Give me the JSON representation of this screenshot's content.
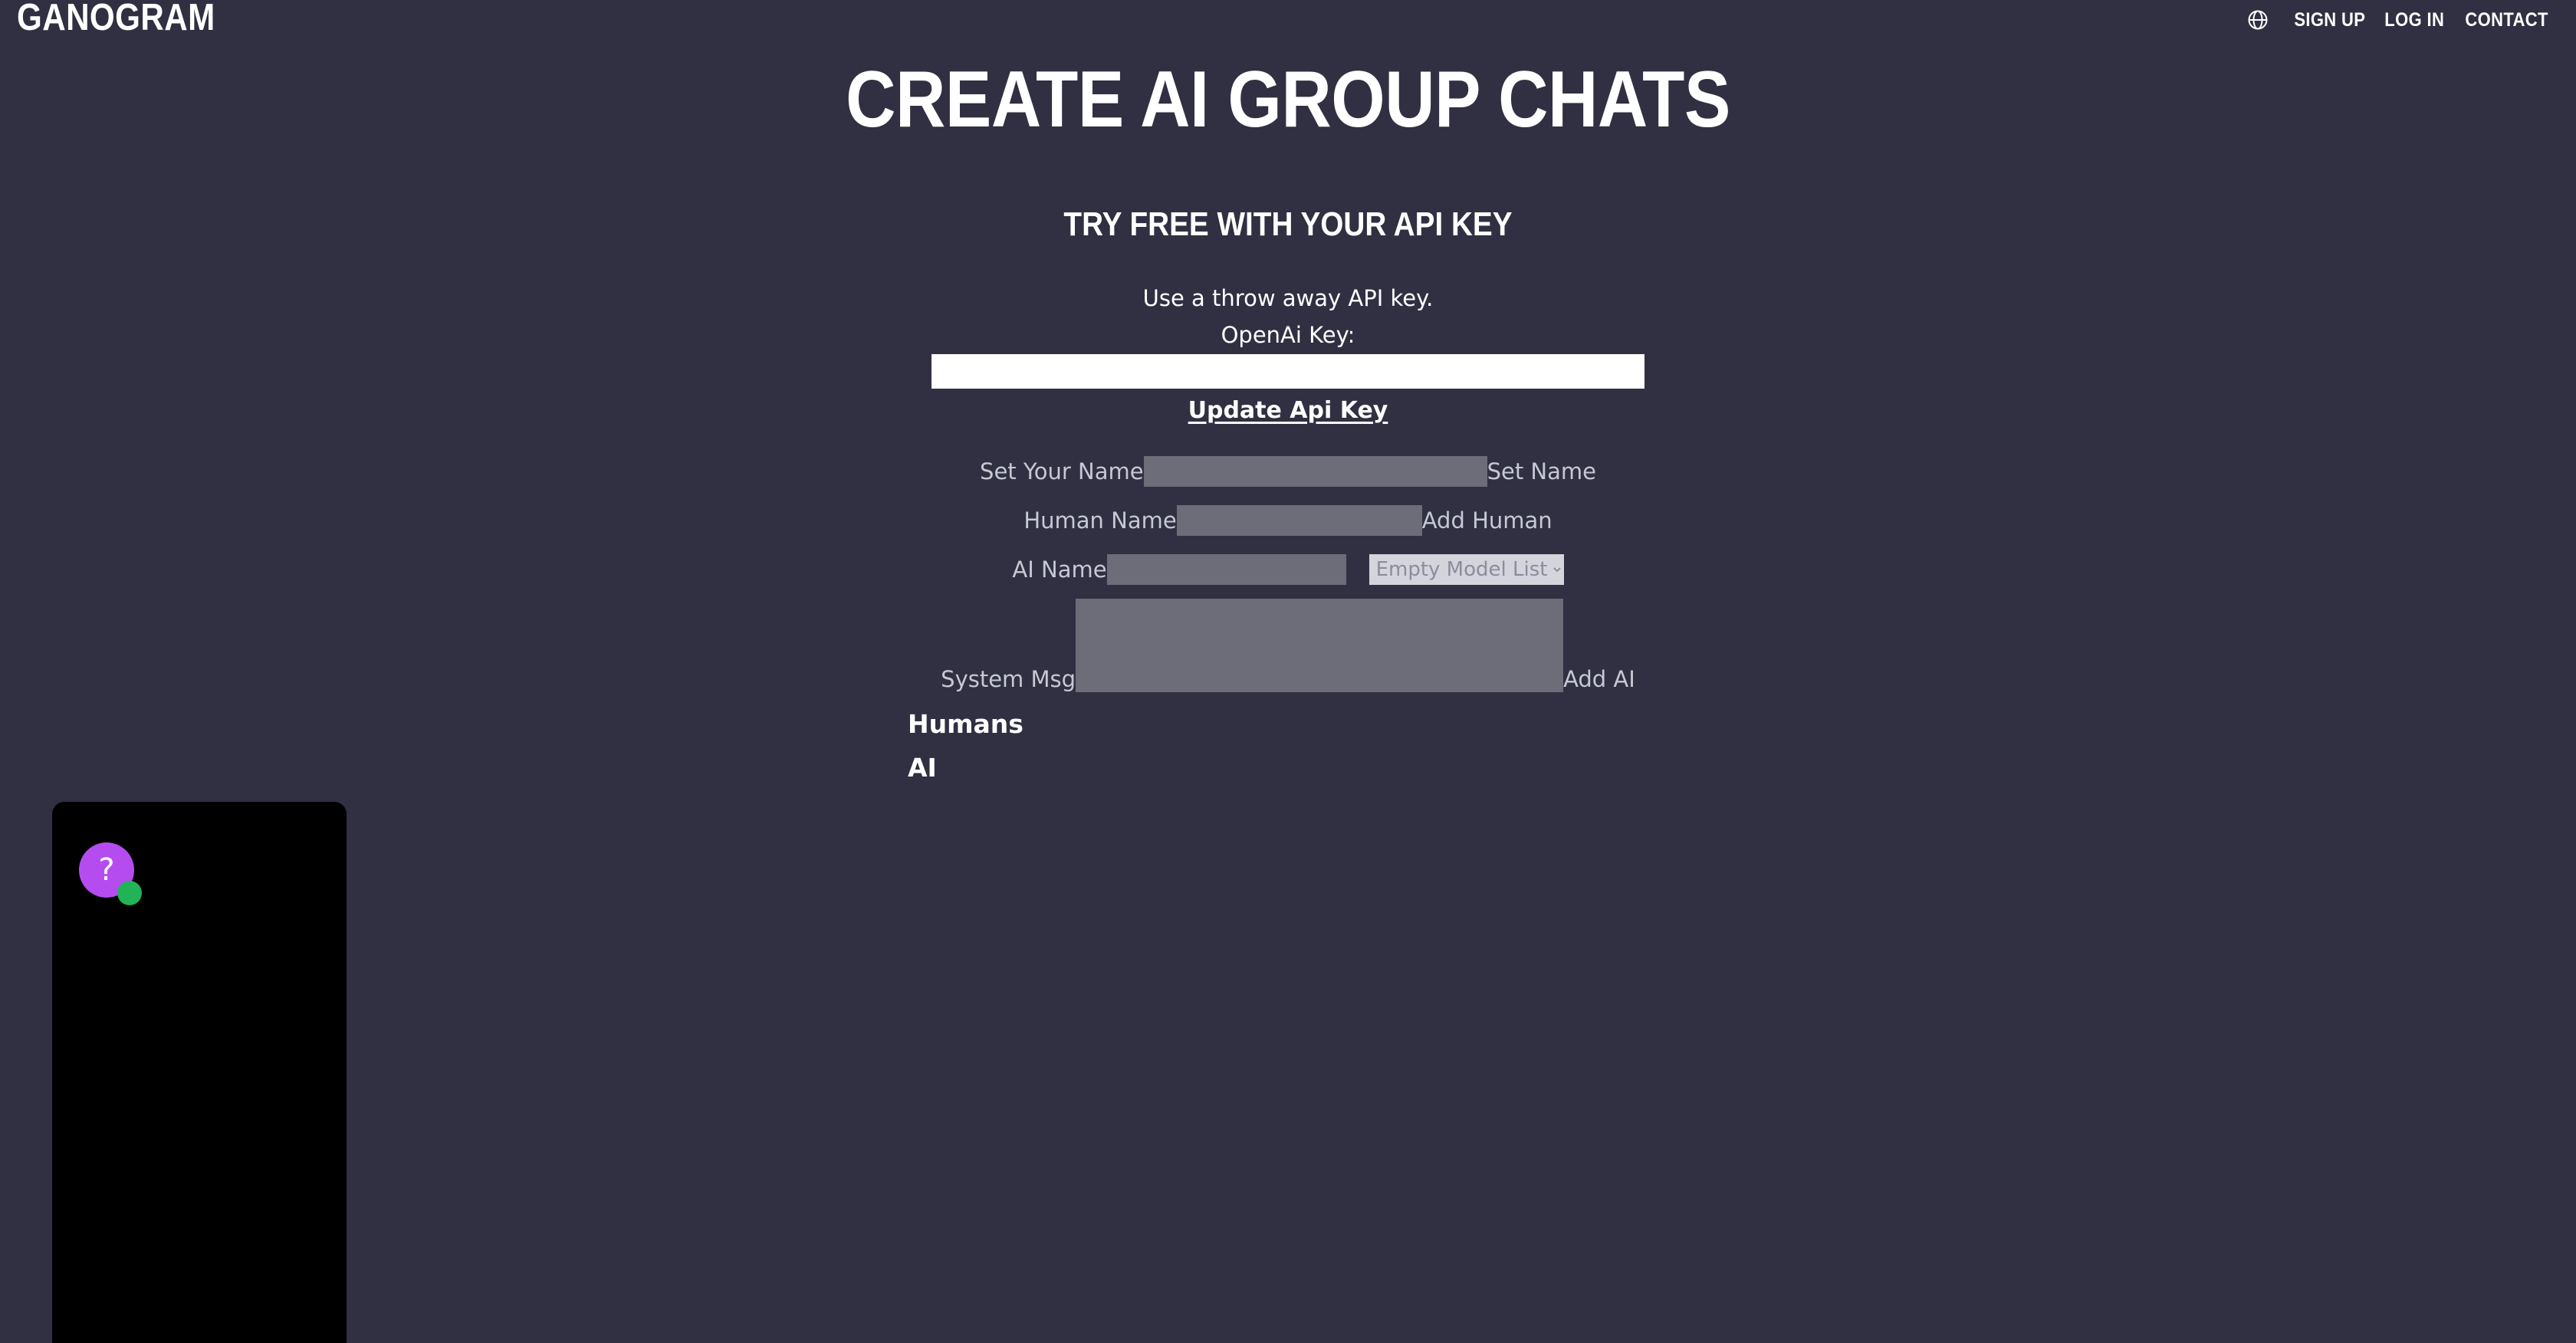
{
  "header": {
    "brand": "GANOGRAM",
    "globe_icon": "globe-icon",
    "nav": [
      {
        "label": "SIGN UP"
      },
      {
        "label": "LOG IN"
      },
      {
        "label": "CONTACT"
      }
    ]
  },
  "hero": {
    "title": "CREATE AI GROUP CHATS",
    "subtitle": "TRY FREE WITH YOUR API KEY",
    "note": "Use a throw away API key.",
    "key_label": "OpenAi Key:"
  },
  "api_key": {
    "value": "",
    "placeholder": "",
    "update_label": "Update Api Key"
  },
  "form": {
    "set_name": {
      "label": "Set Your Name",
      "value": "",
      "placeholder": "",
      "button": "Set Name"
    },
    "human": {
      "label": "Human Name",
      "value": "",
      "placeholder": "",
      "button": "Add Human"
    },
    "ai": {
      "label": "AI Name",
      "value": "",
      "placeholder": "",
      "model_selected": "Empty Model List",
      "model_options": [
        "Empty Model List"
      ]
    },
    "system": {
      "label": "System Msg",
      "value": "",
      "placeholder": "",
      "button": "Add AI"
    }
  },
  "lists": {
    "humans_heading": "Humans",
    "ai_heading": "AI"
  },
  "chat_widget": {
    "avatar_glyph": "?",
    "avatar_color": "#b54cf0",
    "status_color": "#22b357",
    "panel_color": "#000000"
  },
  "colors": {
    "background": "#313042",
    "text": "#ffffff",
    "muted_text": "#c6c8d4",
    "input_fill": "#6d6d7a",
    "select_fill": "#d4d4dc"
  }
}
